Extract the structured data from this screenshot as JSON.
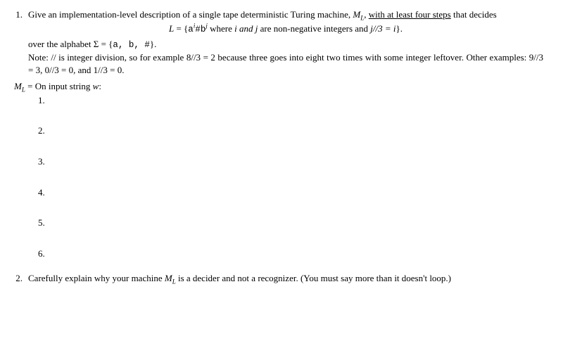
{
  "q1": {
    "number": "1.",
    "intro_pre": "Give an implementation-level description of a single tape deterministic Turing machine, ",
    "intro_ml": "M",
    "intro_ml_sub": "L",
    "intro_mid": ", ",
    "intro_underline": "with at least four steps",
    "intro_post": " that decides",
    "lang_L": "L",
    "lang_eq": " = {",
    "lang_a": "a",
    "lang_i": "i",
    "lang_hash": "#",
    "lang_b": "b",
    "lang_j": "j",
    "lang_where": " where ",
    "lang_iandj": "i and j",
    "lang_nonneg": " are non-negative integers and ",
    "lang_jdiv": "j//3 = i",
    "lang_close": "}.",
    "over_pre": "over the alphabet Σ = {",
    "over_set": "a, b, #",
    "over_post": "}.",
    "note": "Note: // is integer division, so for example 8//3 = 2 because three goes into eight two times with some integer leftover. Other examples: 9//3 = 3, 0//3 = 0, and 1//3 = 0.",
    "ml_header_pre": "M",
    "ml_header_sub": "L",
    "ml_header_post": " = On input string ",
    "ml_header_w": "w",
    "ml_header_colon": ":",
    "steps": [
      "1.",
      "2.",
      "3.",
      "4.",
      "5.",
      "6."
    ]
  },
  "q2": {
    "number": "2.",
    "text_pre": "Carefully explain why your machine ",
    "text_ml": "M",
    "text_ml_sub": "L",
    "text_post": " is a decider and not a recognizer. (You must say more than it doesn't loop.)"
  }
}
